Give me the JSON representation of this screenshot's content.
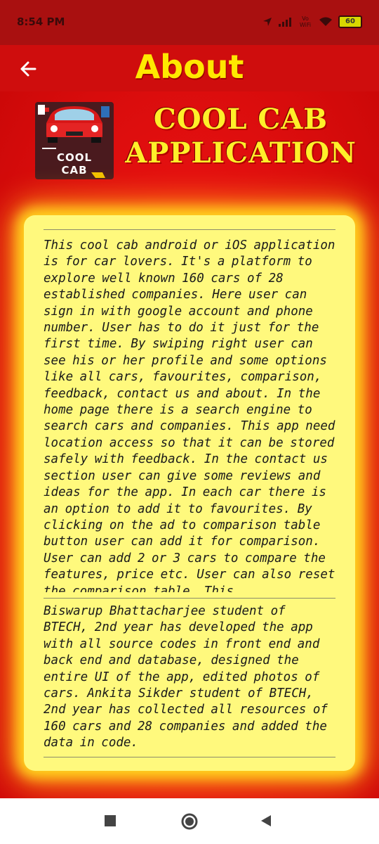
{
  "status_bar": {
    "time": "8:54 PM",
    "network_label": "Vo WiFi",
    "battery": "60"
  },
  "app_bar": {
    "title": "About"
  },
  "header": {
    "logo_line1": "COOL",
    "logo_line2": "CAB",
    "heading_line1": "COOL CAB",
    "heading_line2": "APPLICATION"
  },
  "card": {
    "paragraph1": "This cool cab android or iOS application is for car lovers. It's a platform to explore well known 160 cars of 28 established companies. Here user can sign in with google account and phone number. User has to do it just for the first time. By swiping right user can see his or her profile and some options like all cars, favourites, comparison, feedback, contact us and about. In the home page there is a search engine to search cars and companies. This app need location access so that it can be stored safely with feedback. In the contact us section user can give some reviews and ideas for the app. In each car there is an option to add it to favourites. By clicking on the ad to comparison table button user can add it for comparison. User can add 2 or 3 cars to compare the features, price etc. User can also reset the comparison table. This",
    "paragraph2": "Biswarup Bhattacharjee student of BTECH, 2nd year has developed the app with all source codes in front end and back end and database, designed the entire UI of the app, edited photos of cars. Ankita Sikder student of BTECH, 2nd year has collected all resources of 160 cars and 28 companies and added the data in code."
  },
  "colors": {
    "app_bar": "#cf0d0d",
    "title_yellow": "#ffe800",
    "card_bg": "#fff97d",
    "glow": "#ffd21e"
  },
  "icons": {
    "back": "arrow-left-icon",
    "nav_recents": "square-icon",
    "nav_home": "circle-icon",
    "nav_back": "triangle-back-icon"
  }
}
